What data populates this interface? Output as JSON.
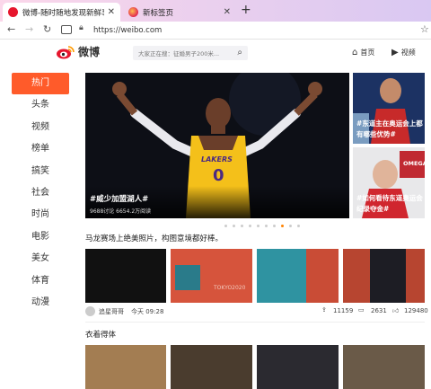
{
  "browser": {
    "tabs": [
      {
        "title": "微博-随时随地发现新鲜事",
        "active": true
      },
      {
        "title": "新标签页",
        "active": false
      }
    ],
    "close_glyph": "✕",
    "new_tab_glyph": "+",
    "url": "https://weibo.com"
  },
  "site": {
    "logo_text": "微博",
    "search_placeholder": "大家正在搜：征婚男子200米...",
    "nav": {
      "home": "首页",
      "video": "视频"
    },
    "sidebar": [
      "热门",
      "头条",
      "视频",
      "榜单",
      "搞笑",
      "社会",
      "时尚",
      "电影",
      "美女",
      "体育",
      "动漫"
    ],
    "hero": {
      "title": "#威少加盟湖人#",
      "stats": "9688讨论   6654.2万阅读",
      "jersey_team": "LAKERS",
      "jersey_number": "0"
    },
    "side_cards": [
      {
        "title": "#东道主在奥运会上都有哪些优势#"
      },
      {
        "title": "#如何看待东道奥运会纪录夺金#"
      }
    ],
    "side_logo_text": "OMEGA",
    "carousel": {
      "count": 10,
      "active_index": 7
    },
    "post": {
      "headline": "马龙赛场上绝美照片，构图意境都好棒。",
      "author": "追星哥哥",
      "time": "今天 09:28",
      "reposts": "11159",
      "comments": "2631",
      "likes": "129480",
      "thumb_watermark": "TOKYO2020"
    },
    "section2_title": "衣着得体"
  },
  "colors": {
    "accent": "#ff5b2a",
    "dot_active": "#ff8200"
  }
}
